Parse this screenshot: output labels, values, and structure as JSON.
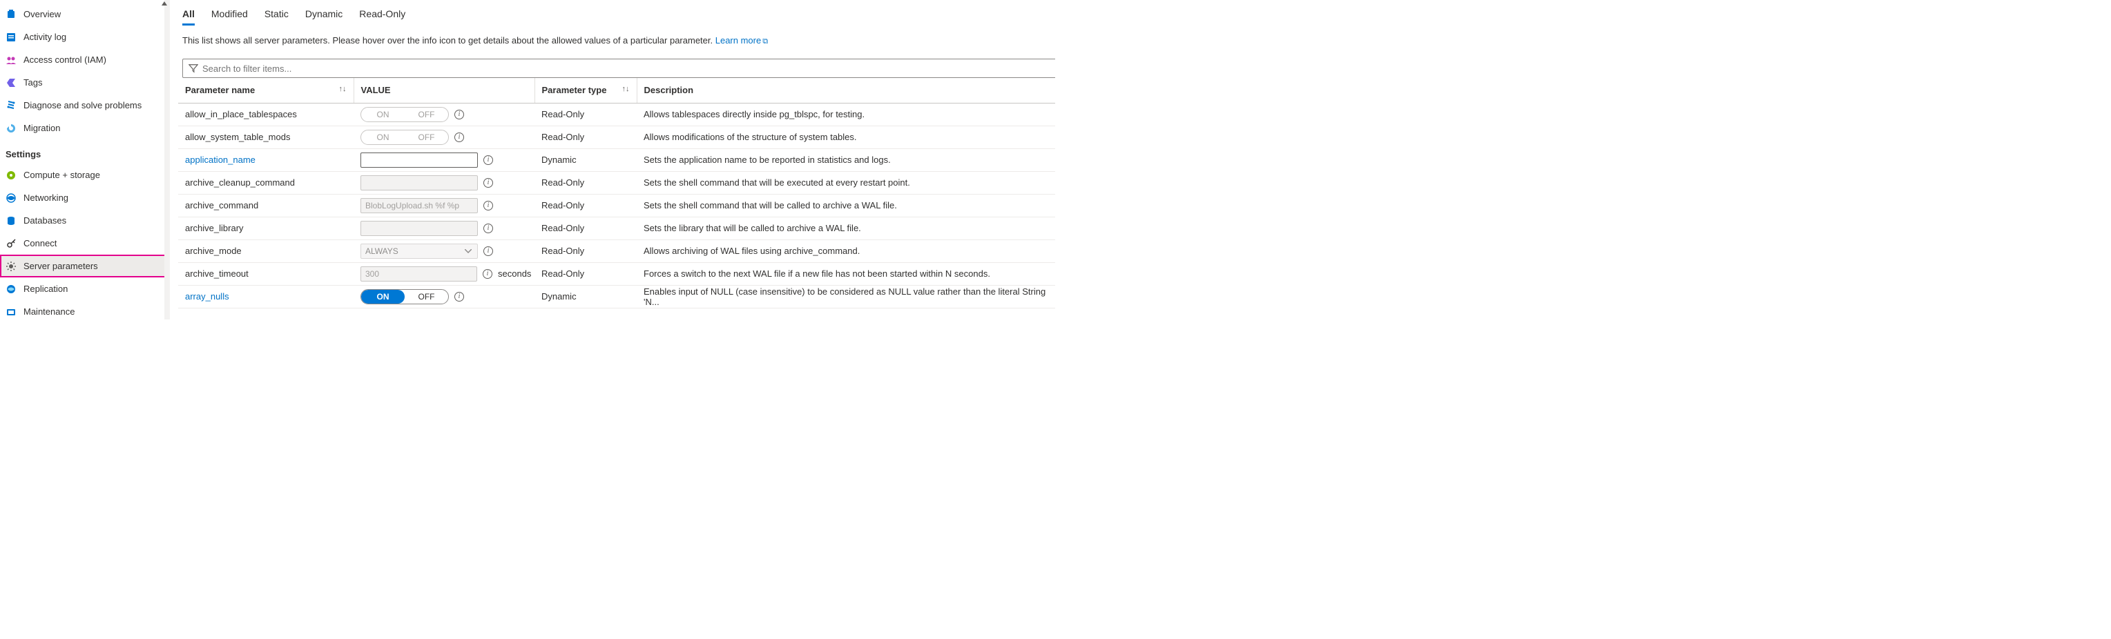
{
  "sidebar": {
    "items": [
      {
        "label": "Overview",
        "color": "#0078d4"
      },
      {
        "label": "Activity log",
        "color": "#0078d4"
      },
      {
        "label": "Access control (IAM)",
        "color": "#c43ab6"
      },
      {
        "label": "Tags",
        "color": "#7160e8"
      },
      {
        "label": "Diagnose and solve problems",
        "color": "#0078d4"
      },
      {
        "label": "Migration",
        "color": "#50b0e9"
      }
    ],
    "settings_heading": "Settings",
    "settings": [
      {
        "label": "Compute + storage",
        "color": "#7fba00"
      },
      {
        "label": "Networking",
        "color": "#0078d4"
      },
      {
        "label": "Databases",
        "color": "#0078d4"
      },
      {
        "label": "Connect",
        "color": "#323130"
      },
      {
        "label": "Server parameters",
        "color": "#605e5c",
        "active": true
      },
      {
        "label": "Replication",
        "color": "#0078d4"
      },
      {
        "label": "Maintenance",
        "color": "#0078d4"
      }
    ]
  },
  "tabs": [
    "All",
    "Modified",
    "Static",
    "Dynamic",
    "Read-Only"
  ],
  "active_tab": "All",
  "info_text": "This list shows all server parameters. Please hover over the info icon to get details about the allowed values of a particular parameter. ",
  "learn_more": "Learn more",
  "search_placeholder": "Search to filter items...",
  "columns": {
    "name": "Parameter name",
    "value": "VALUE",
    "type": "Parameter type",
    "desc": "Description"
  },
  "rows": [
    {
      "name": "allow_in_place_tablespaces",
      "kind": "toggle",
      "enabled": false,
      "on": false,
      "type": "Read-Only",
      "desc": "Allows tablespaces directly inside pg_tblspc, for testing."
    },
    {
      "name": "allow_system_table_mods",
      "kind": "toggle",
      "enabled": false,
      "on": false,
      "type": "Read-Only",
      "desc": "Allows modifications of the structure of system tables."
    },
    {
      "name": "application_name",
      "link": true,
      "kind": "text",
      "enabled": true,
      "value": "",
      "type": "Dynamic",
      "desc": "Sets the application name to be reported in statistics and logs."
    },
    {
      "name": "archive_cleanup_command",
      "kind": "text",
      "enabled": false,
      "value": "",
      "type": "Read-Only",
      "desc": "Sets the shell command that will be executed at every restart point."
    },
    {
      "name": "archive_command",
      "kind": "text",
      "enabled": false,
      "value": "BlobLogUpload.sh %f %p",
      "type": "Read-Only",
      "desc": "Sets the shell command that will be called to archive a WAL file."
    },
    {
      "name": "archive_library",
      "kind": "text",
      "enabled": false,
      "value": "",
      "type": "Read-Only",
      "desc": "Sets the library that will be called to archive a WAL file."
    },
    {
      "name": "archive_mode",
      "kind": "select",
      "enabled": false,
      "value": "ALWAYS",
      "type": "Read-Only",
      "desc": "Allows archiving of WAL files using archive_command."
    },
    {
      "name": "archive_timeout",
      "kind": "text",
      "enabled": false,
      "value": "300",
      "unit": "seconds",
      "type": "Read-Only",
      "desc": "Forces a switch to the next WAL file if a new file has not been started within N seconds."
    },
    {
      "name": "array_nulls",
      "link": true,
      "kind": "toggle",
      "enabled": true,
      "on": true,
      "type": "Dynamic",
      "desc": "Enables input of NULL (case insensitive) to be considered as NULL value rather than the literal String 'N..."
    }
  ],
  "toggle_labels": {
    "on": "ON",
    "off": "OFF"
  }
}
